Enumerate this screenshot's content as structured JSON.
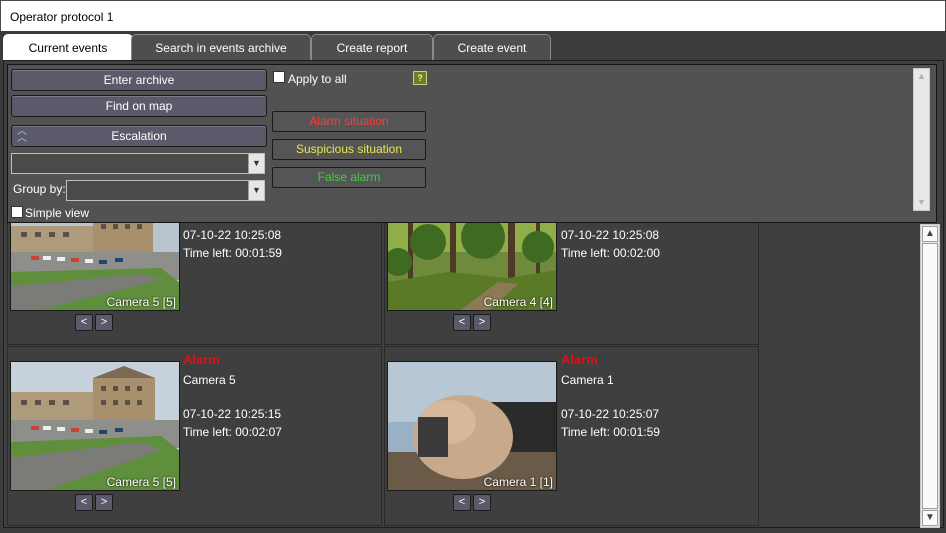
{
  "window": {
    "title": "Operator protocol 1"
  },
  "tabs": [
    {
      "label": "Current events"
    },
    {
      "label": "Search in events archive"
    },
    {
      "label": "Create report"
    },
    {
      "label": "Create event"
    }
  ],
  "panel": {
    "enter_archive": "Enter archive",
    "find_on_map": "Find on map",
    "escalation": "Escalation",
    "group_by_label": "Group by:",
    "simple_view": "Simple view",
    "apply_to_all": "Apply to all",
    "help": "?",
    "situations": {
      "alarm": "Alarm situation",
      "suspicious": "Suspicious situation",
      "false_alarm": "False alarm"
    }
  },
  "events": [
    {
      "title": "",
      "camera": "",
      "datetime": "07-10-22 10:25:08",
      "time_left": "Time left: 00:01:59",
      "caption": "Camera 5 [5]"
    },
    {
      "title": "",
      "camera": "",
      "datetime": "07-10-22 10:25:08",
      "time_left": "Time left: 00:02:00",
      "caption": "Camera 4 [4]"
    },
    {
      "title": "Alarm",
      "camera": "Camera 5",
      "datetime": "07-10-22 10:25:15",
      "time_left": "Time left: 00:02:07",
      "caption": "Camera 5 [5]"
    },
    {
      "title": "Alarm",
      "camera": "Camera 1",
      "datetime": "07-10-22 10:25:07",
      "time_left": "Time left: 00:01:59",
      "caption": "Camera 1 [1]"
    }
  ],
  "nav": {
    "prev": "<",
    "next": ">"
  },
  "icons": {
    "escalation": "double-chevron-up-icon",
    "dropdown": "chevron-down-icon",
    "scroll_up": "arrow-up-icon",
    "scroll_down": "arrow-down-icon"
  },
  "colors": {
    "alarm_red": "#dd1111",
    "situation_alarm": "#ff3b3b",
    "situation_suspicious": "#e8e84a",
    "situation_false": "#3fcf3f",
    "help_badge": "#6e7e2e"
  }
}
